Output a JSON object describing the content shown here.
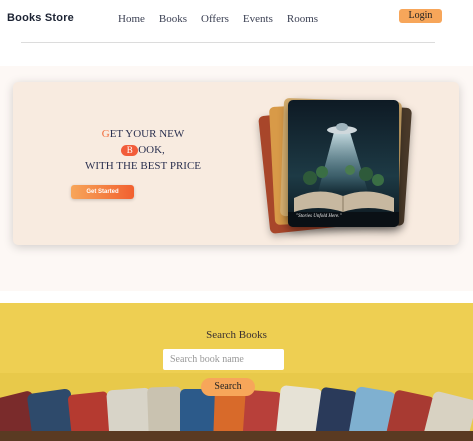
{
  "brand": "Books Store",
  "nav": {
    "links": [
      "Home",
      "Books",
      "Offers",
      "Events",
      "Rooms"
    ],
    "login_label": "Login"
  },
  "hero": {
    "line1_first": "G",
    "line1_rest": "ET YOUR NEW",
    "line2_pill": "B",
    "line2_rest": "OOK,",
    "line3": "WITH THE BEST PRICE",
    "cta_label": "Get Started",
    "cover_tagline": "\"Stories Unfold Here.\""
  },
  "search": {
    "title": "Search Books",
    "placeholder": "Search book name",
    "button_label": "Search"
  },
  "colors": {
    "accent_orange": "#f7a65a",
    "cta_red": "#f25c3a",
    "hero_card": "#f8ebe0",
    "search_bg": "#e8c94a",
    "brand_text": "#1c2333"
  }
}
